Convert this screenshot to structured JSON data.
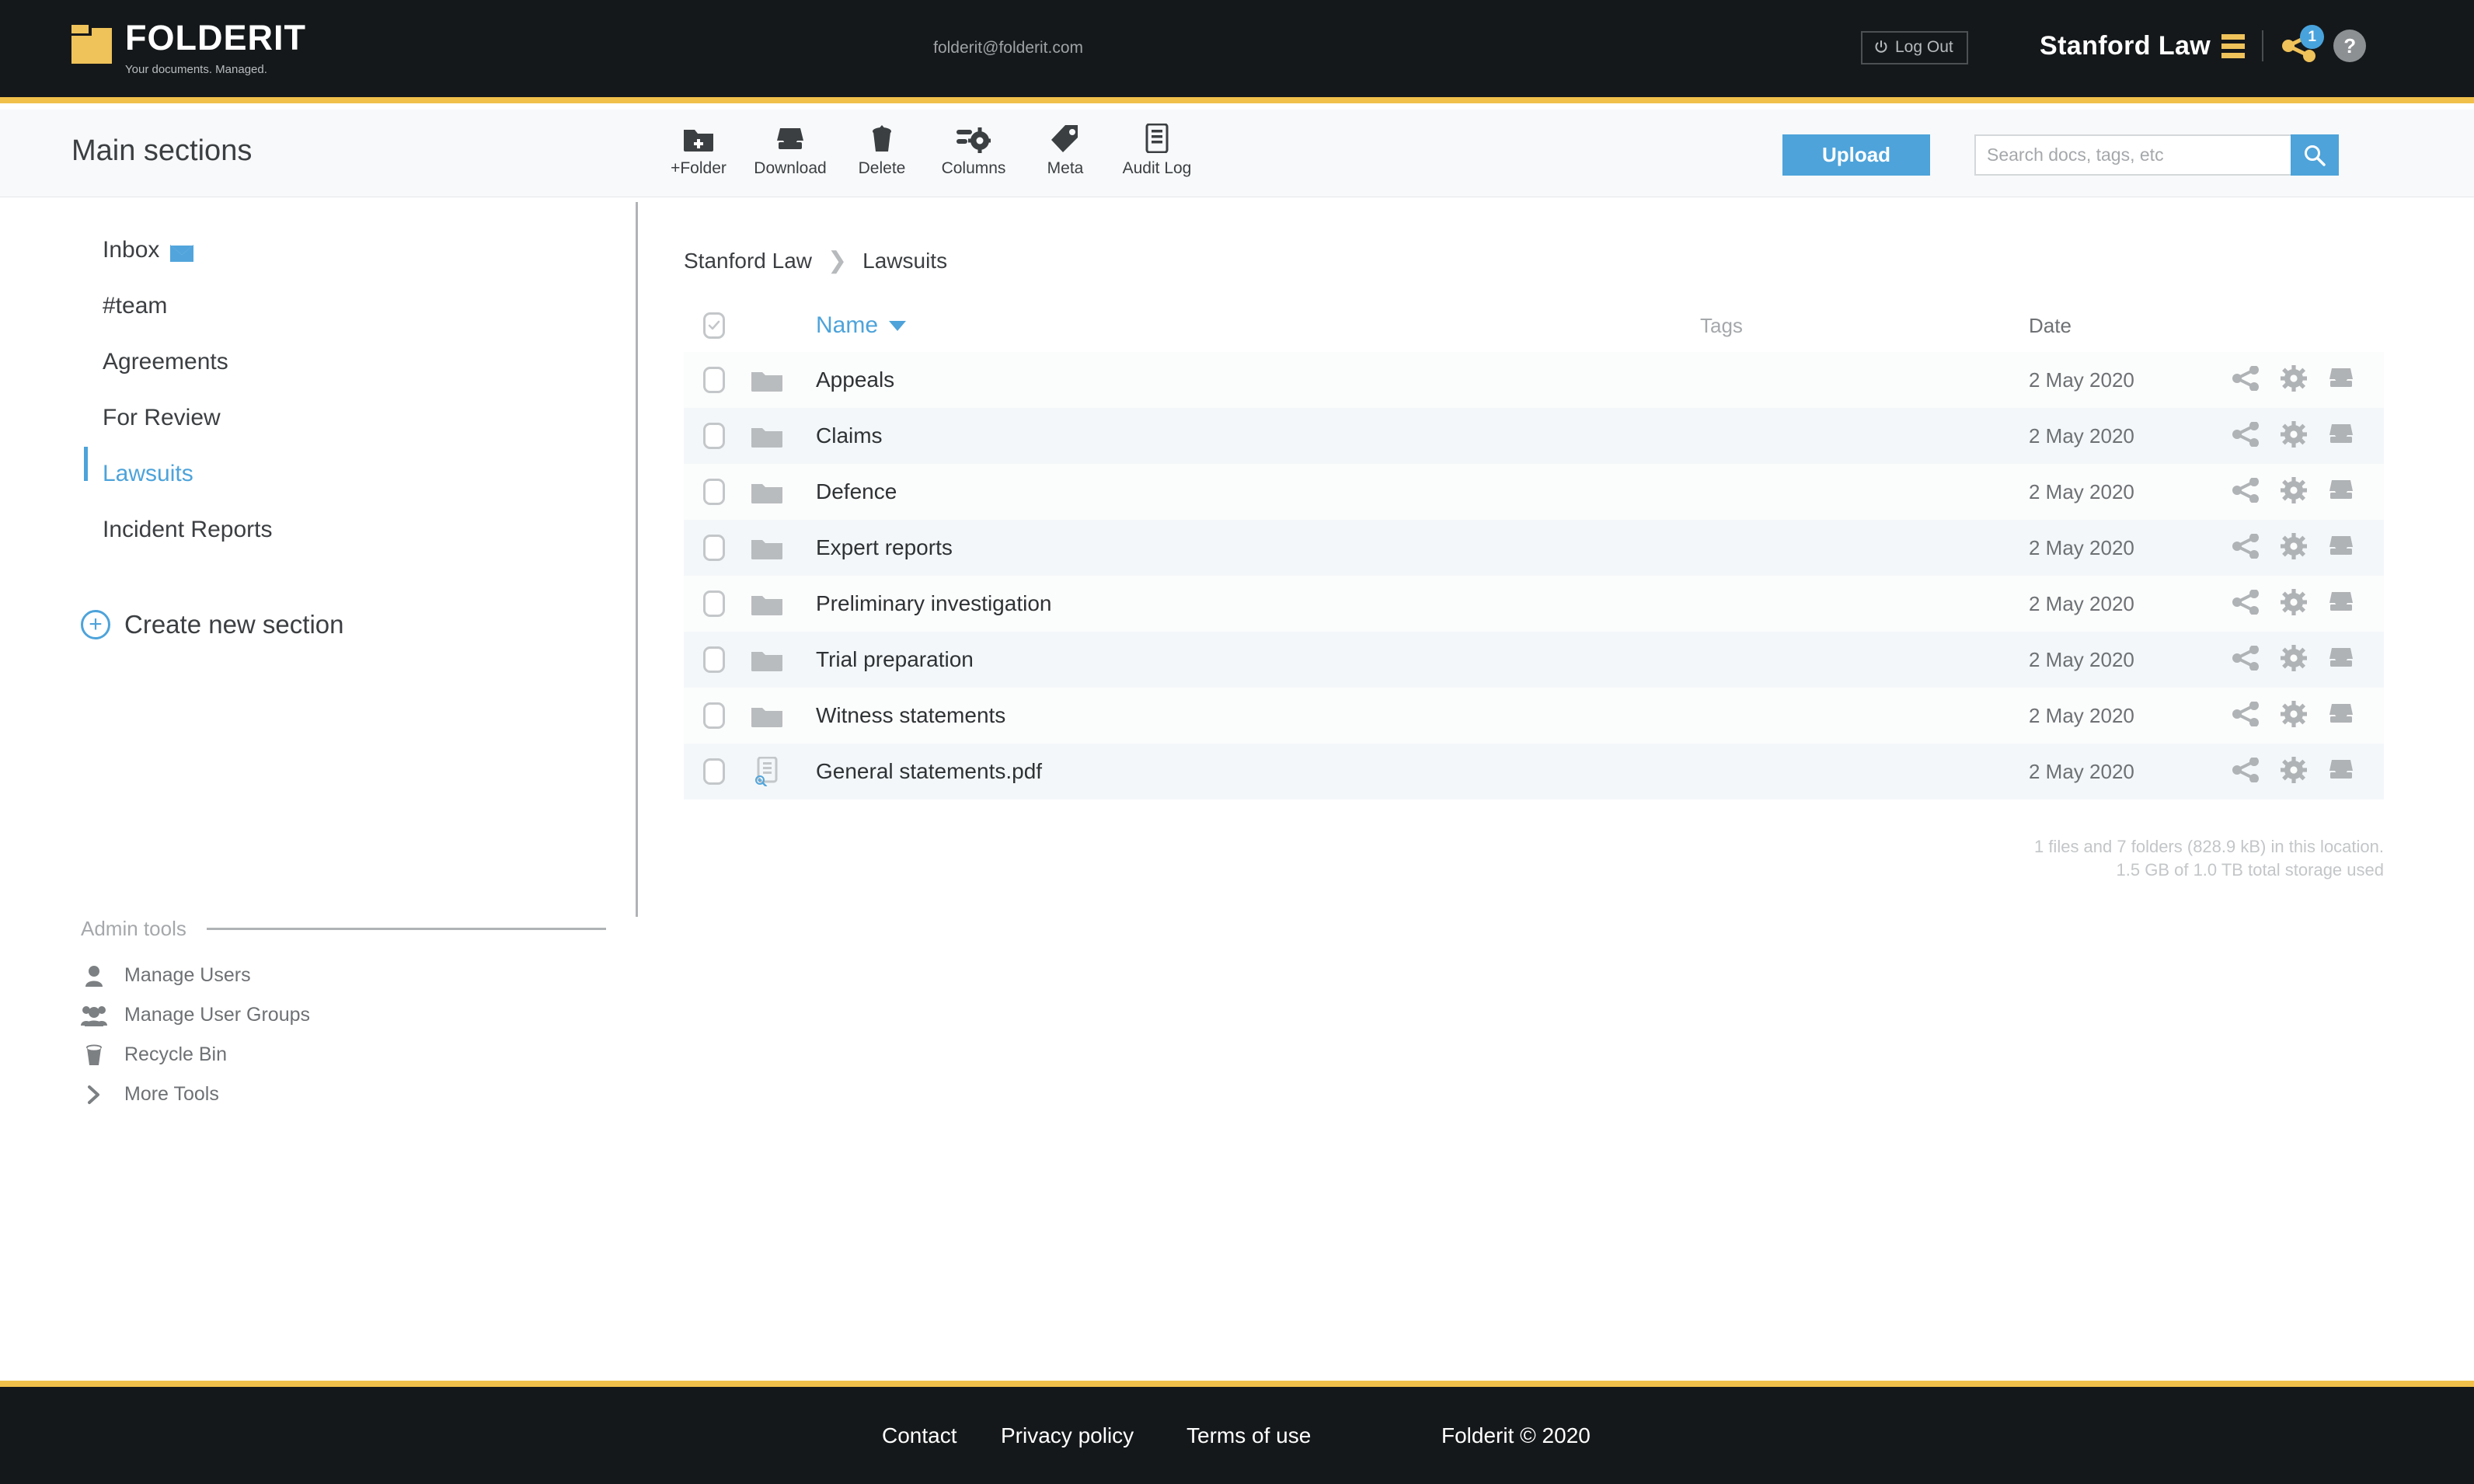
{
  "brand": {
    "name": "FOLDERIT",
    "tagline": "Your documents. Managed.",
    "accent_yellow": "#f0c04a",
    "accent_blue": "#4da3da",
    "dark": "#15181a"
  },
  "topbar": {
    "email": "folderit@folderit.com",
    "logout_label": "Log Out",
    "org_name": "Stanford Law",
    "share_badge_count": "1",
    "help_label": "?"
  },
  "subheader": {
    "title": "Main sections",
    "tools": [
      {
        "label": "+Folder",
        "icon": "folder-plus-icon"
      },
      {
        "label": "Download",
        "icon": "download-icon"
      },
      {
        "label": "Delete",
        "icon": "trash-icon"
      },
      {
        "label": "Columns",
        "icon": "columns-settings-icon"
      },
      {
        "label": "Meta",
        "icon": "tag-icon"
      },
      {
        "label": "Audit Log",
        "icon": "audit-log-icon"
      }
    ],
    "upload_label": "Upload",
    "search_placeholder": "Search docs, tags, etc",
    "search_value": ""
  },
  "sidebar": {
    "items": [
      {
        "label": "Inbox",
        "icon": "mail-icon",
        "active": false
      },
      {
        "label": "#team",
        "icon": "",
        "active": false
      },
      {
        "label": "Agreements",
        "icon": "",
        "active": false
      },
      {
        "label": "For Review",
        "icon": "",
        "active": false
      },
      {
        "label": "Lawsuits",
        "icon": "",
        "active": true
      },
      {
        "label": "Incident Reports",
        "icon": "",
        "active": false
      }
    ],
    "create_new_label": "Create new section",
    "admin_title": "Admin tools",
    "admin_items": [
      {
        "label": "Manage Users",
        "icon": "user-icon"
      },
      {
        "label": "Manage User Groups",
        "icon": "users-group-icon"
      },
      {
        "label": "Recycle Bin",
        "icon": "trash-icon"
      },
      {
        "label": "More Tools",
        "icon": "chevron-right-icon"
      }
    ]
  },
  "breadcrumb": {
    "root": "Stanford Law",
    "current": "Lawsuits"
  },
  "table": {
    "columns": {
      "name": "Name",
      "tags": "Tags",
      "date": "Date"
    },
    "sort_column": "Name",
    "sort_direction": "desc",
    "rows": [
      {
        "name": "Appeals",
        "type": "folder",
        "tags": "",
        "date": "2 May 2020"
      },
      {
        "name": "Claims",
        "type": "folder",
        "tags": "",
        "date": "2 May 2020"
      },
      {
        "name": "Defence",
        "type": "folder",
        "tags": "",
        "date": "2 May 2020"
      },
      {
        "name": "Expert reports",
        "type": "folder",
        "tags": "",
        "date": "2 May 2020"
      },
      {
        "name": "Preliminary investigation",
        "type": "folder",
        "tags": "",
        "date": "2 May 2020"
      },
      {
        "name": "Trial preparation",
        "type": "folder",
        "tags": "",
        "date": "2 May 2020"
      },
      {
        "name": "Witness statements",
        "type": "folder",
        "tags": "",
        "date": "2 May 2020"
      },
      {
        "name": "General statements.pdf",
        "type": "file",
        "tags": "",
        "date": "2 May 2020"
      }
    ],
    "row_actions": [
      "share-icon",
      "gear-icon",
      "download-icon"
    ]
  },
  "storage": {
    "line1": "1 files and 7 folders (828.9 kB) in this location.",
    "line2": "1.5 GB of 1.0 TB total storage used"
  },
  "footer": {
    "links": [
      "Contact",
      "Privacy policy",
      "Terms of use"
    ],
    "copyright": "Folderit © 2020"
  }
}
